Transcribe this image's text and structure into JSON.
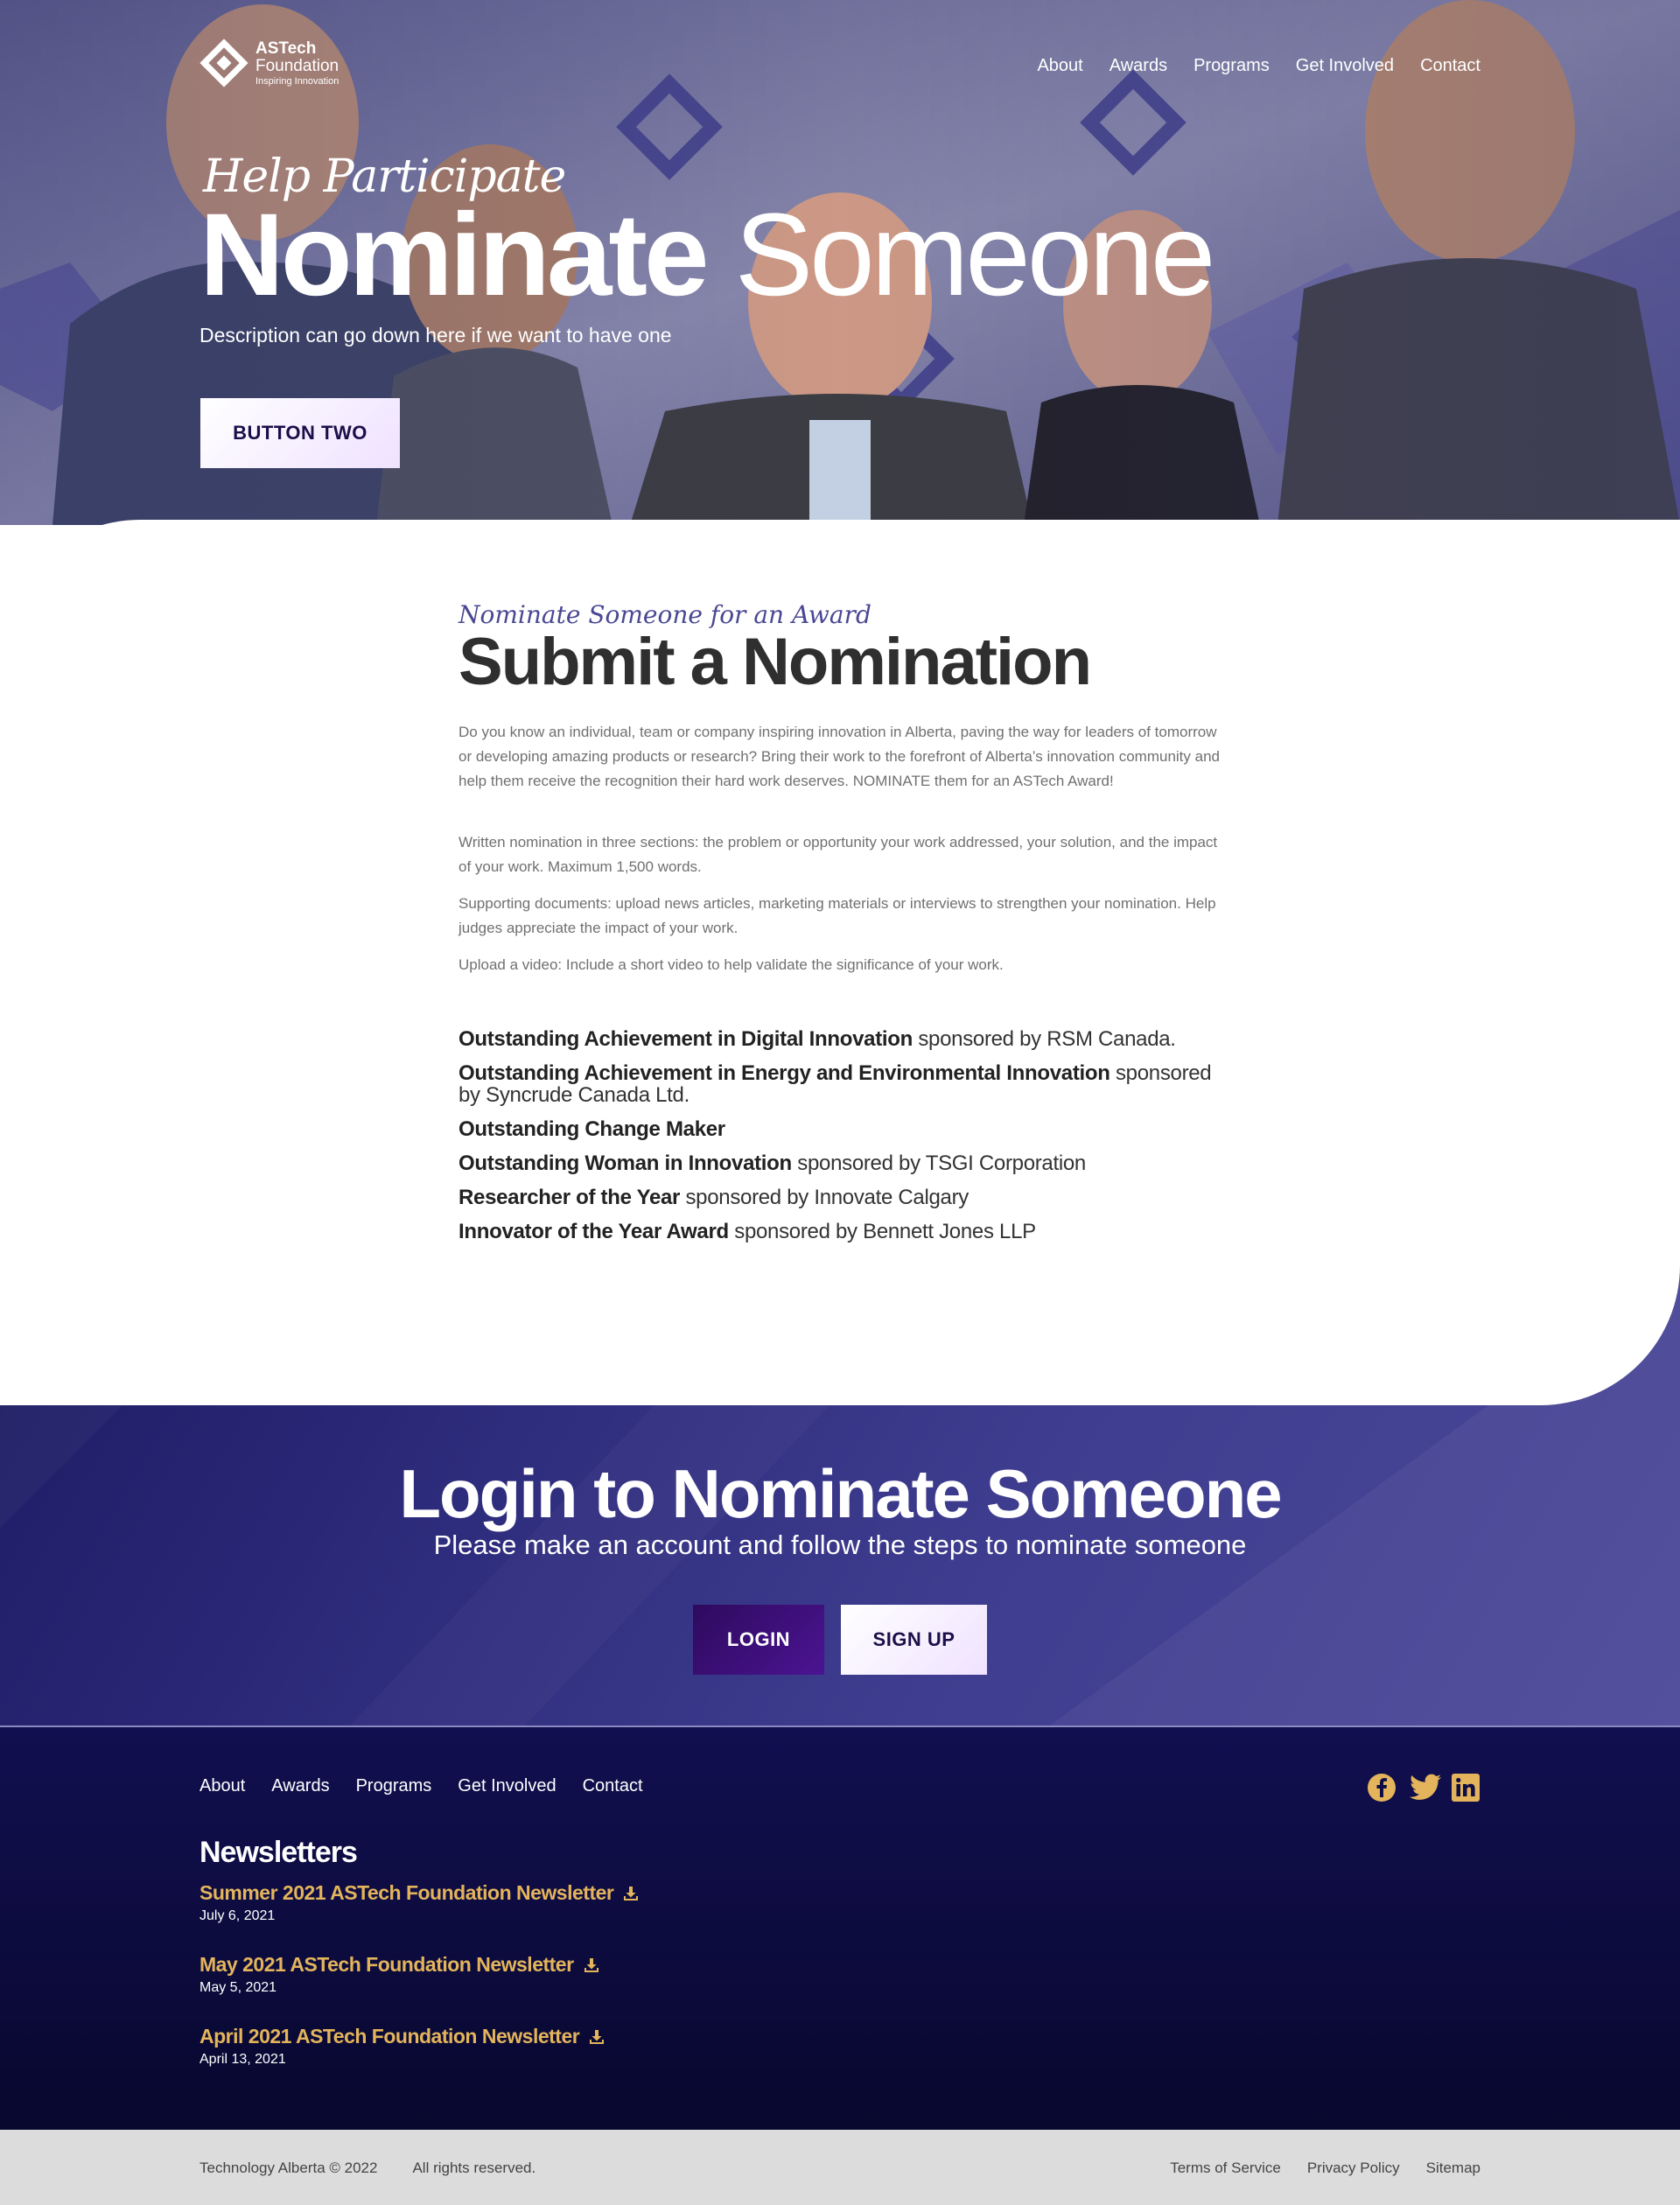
{
  "brand": {
    "name_line1": "ASTech",
    "name_line2": "Foundation",
    "tagline": "Inspiring Innovation",
    "accent": "#4a4893",
    "gold": "#e3b45b",
    "navy": "#110f4f"
  },
  "nav": {
    "items": [
      "About",
      "Awards",
      "Programs",
      "Get Involved",
      "Contact"
    ]
  },
  "hero": {
    "kicker": "Help Participate",
    "title_bold": "Nominate",
    "title_light": "Someone",
    "description": "Description can go down here if we want to have one",
    "button_label": "BUTTON TWO",
    "photo_logo_words": [
      "ASTech",
      "Foundation",
      "Inspiring Innovation"
    ]
  },
  "content": {
    "kicker": "Nominate Someone for an Award",
    "title_light": "Submit a",
    "title_bold": "Nomination",
    "intro": "Do you know an individual, team or company inspiring innovation in Alberta, paving the way for leaders of tomorrow or developing amazing products or research? Bring their work to the forefront of Alberta’s innovation community and help them receive the recognition their hard work deserves. NOMINATE them for an ASTech Award!",
    "requirements": [
      "Written nomination in three sections: the problem or opportunity your work addressed, your solution, and the impact of your work. Maximum 1,500 words.",
      "Supporting documents: upload news articles, marketing materials or interviews to strengthen your nomination.  Help judges appreciate the impact of your work.",
      "Upload a video: Include a short video to help validate the significance of your work."
    ],
    "awards": [
      {
        "name": "Outstanding Achievement in Digital Innovation",
        "sponsor": " sponsored by RSM Canada."
      },
      {
        "name": "Outstanding Achievement in Energy and Environmental Innovation",
        "sponsor": " sponsored by Syncrude Canada Ltd."
      },
      {
        "name": "Outstanding Change Maker",
        "sponsor": ""
      },
      {
        "name": "Outstanding Woman in Innovation",
        "sponsor": " sponsored by TSGI Corporation"
      },
      {
        "name": "Researcher of the Year",
        "sponsor": " sponsored by Innovate Calgary"
      },
      {
        "name": "Innovator of the Year Award",
        "sponsor": " sponsored by Bennett Jones LLP"
      }
    ]
  },
  "login": {
    "title": "Login to Nominate Someone",
    "subtitle": "Please make an account and follow the steps to nominate someone",
    "login_label": "LOGIN",
    "signup_label": "SIGN UP"
  },
  "footer": {
    "nav": [
      "About",
      "Awards",
      "Programs",
      "Get Involved",
      "Contact"
    ],
    "socials": [
      "facebook-icon",
      "twitter-icon",
      "linkedin-icon"
    ],
    "newsletters_title": "Newsletters",
    "newsletters": [
      {
        "title": "Summer 2021 ASTech Foundation Newsletter",
        "date": "July 6, 2021"
      },
      {
        "title": "May 2021 ASTech Foundation Newsletter",
        "date": "May 5, 2021"
      },
      {
        "title": "April 2021 ASTech Foundation Newsletter",
        "date": "April 13, 2021"
      }
    ],
    "copyright": "Technology Alberta © 2022",
    "rights": "All rights reserved.",
    "legal": [
      "Terms of Service",
      "Privacy Policy",
      "Sitemap"
    ]
  }
}
